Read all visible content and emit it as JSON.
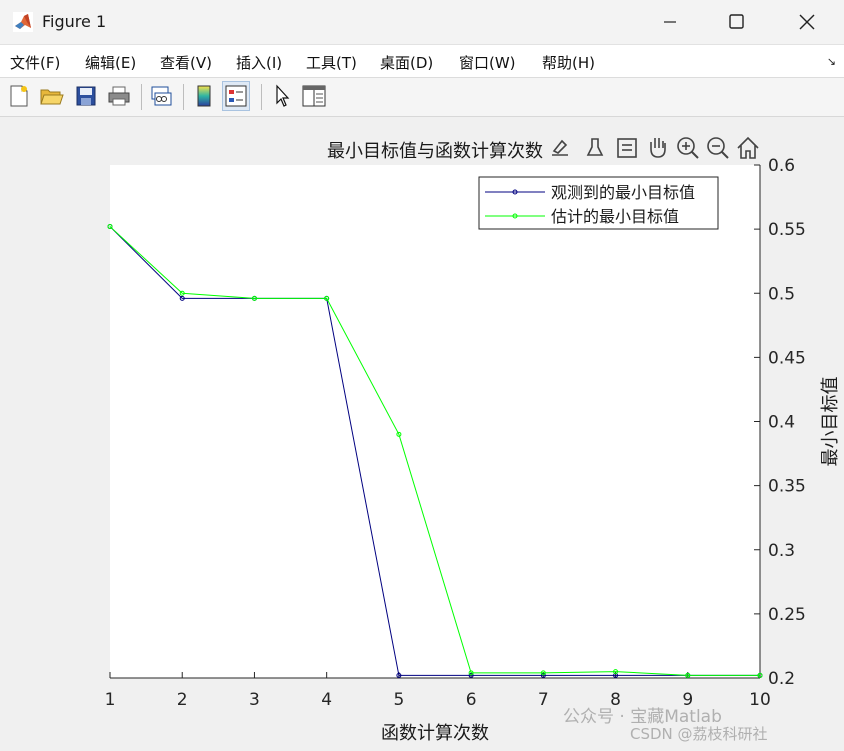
{
  "window": {
    "title": "Figure 1",
    "minimize_icon": "minimize-icon",
    "maximize_icon": "maximize-icon",
    "close_icon": "close-icon"
  },
  "menu": {
    "items": [
      {
        "label": "文件(F)"
      },
      {
        "label": "编辑(E)"
      },
      {
        "label": "查看(V)"
      },
      {
        "label": "插入(I)"
      },
      {
        "label": "工具(T)"
      },
      {
        "label": "桌面(D)"
      },
      {
        "label": "窗口(W)"
      },
      {
        "label": "帮助(H)"
      }
    ],
    "dock_arrow": "↘"
  },
  "toolbar": {
    "buttons": [
      "new-figure-icon",
      "open-file-icon",
      "save-icon",
      "print-icon",
      "link-plot-icon",
      "colorbar-icon",
      "legend-icon",
      "pointer-icon",
      "property-inspector-icon"
    ]
  },
  "axes_toolbar": {
    "buttons": [
      "export-icon",
      "brush-icon",
      "data-tips-icon",
      "pan-icon",
      "zoom-in-icon",
      "zoom-out-icon",
      "home-icon"
    ]
  },
  "chart_data": {
    "type": "line",
    "title": "最小目标值与函数计算次数",
    "xlabel": "函数计算次数",
    "ylabel": "最小目标值",
    "xlim": [
      1,
      10
    ],
    "ylim": [
      0.2,
      0.6
    ],
    "x_ticks": [
      "1",
      "2",
      "3",
      "4",
      "5",
      "6",
      "7",
      "8",
      "9",
      "10"
    ],
    "y_ticks": [
      "0.2",
      "0.25",
      "0.3",
      "0.35",
      "0.4",
      "0.45",
      "0.5",
      "0.55",
      "0.6"
    ],
    "y_axis_location": "right",
    "grid": false,
    "legend_location": "top-right",
    "x": [
      1,
      2,
      3,
      4,
      5,
      6,
      7,
      8,
      9,
      10
    ],
    "series": [
      {
        "name": "观测到的最小目标值",
        "color": "#000080",
        "values": [
          0.552,
          0.496,
          0.496,
          0.496,
          0.202,
          0.202,
          0.202,
          0.202,
          0.202,
          0.202
        ]
      },
      {
        "name": "估计的最小目标值",
        "color": "#00ff00",
        "values": [
          0.552,
          0.5,
          0.496,
          0.496,
          0.39,
          0.204,
          0.204,
          0.205,
          0.202,
          0.202
        ]
      }
    ]
  },
  "watermarks": {
    "wechat": "公众号 · 宝藏Matlab",
    "csdn": "CSDN @荔枝科研社"
  }
}
